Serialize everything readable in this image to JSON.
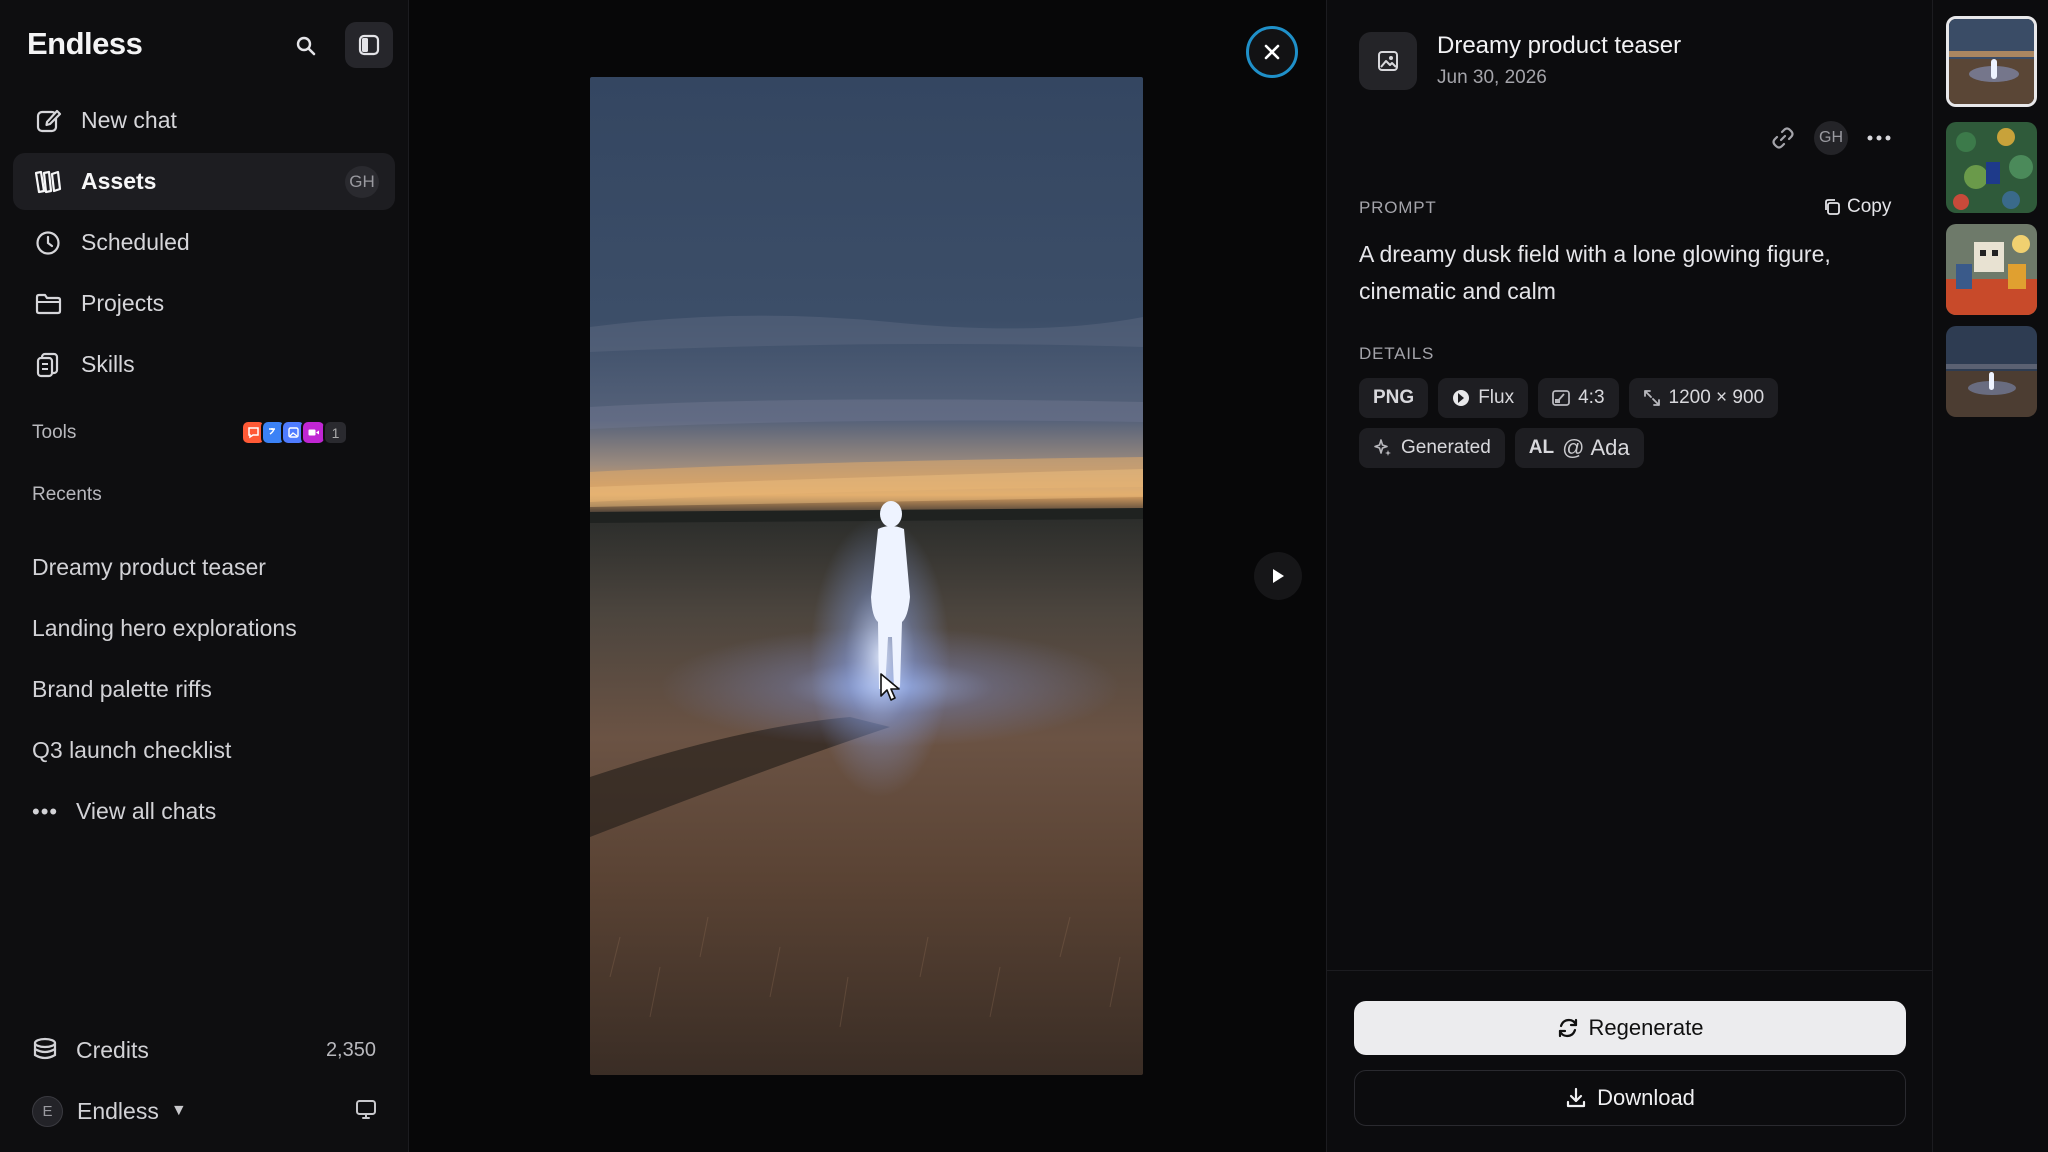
{
  "app": {
    "brand": "Endless"
  },
  "sidebar": {
    "nav": [
      {
        "label": "New chat",
        "icon": "compose-icon"
      },
      {
        "label": "Assets",
        "icon": "assets-icon",
        "active": true,
        "badge": "GH"
      },
      {
        "label": "Scheduled",
        "icon": "clock-icon"
      },
      {
        "label": "Projects",
        "icon": "folder-icon"
      },
      {
        "label": "Skills",
        "icon": "skills-icon"
      }
    ],
    "tools_label": "Tools",
    "tools_count": "1",
    "tool_colors": [
      "#ff5a36",
      "#3b82f6",
      "#4f7cff",
      "#c026d3"
    ],
    "recents_label": "Recents",
    "recents": [
      "Dreamy product teaser",
      "Landing hero explorations",
      "Brand palette riffs",
      "Q3 launch checklist"
    ],
    "view_all": "View all chats",
    "credits_label": "Credits",
    "credits_value": "2,350",
    "account_initial": "E",
    "account_name": "Endless"
  },
  "viewer": {
    "accent": "#1f90c9"
  },
  "details": {
    "title": "Dreamy product teaser",
    "date": "Jun 30, 2026",
    "owner_badge": "GH",
    "prompt_label": "PROMPT",
    "copy_label": "Copy",
    "prompt": "A dreamy dusk field with a lone glowing figure, cinematic and calm",
    "details_label": "DETAILS",
    "format": "PNG",
    "model": "Flux",
    "aspect": "4:3",
    "dimensions": "1200 × 900",
    "source": "Generated",
    "author_initials": "AL",
    "author_at": "@",
    "author_name": "Ada",
    "regenerate_label": "Regenerate",
    "download_label": "Download"
  }
}
